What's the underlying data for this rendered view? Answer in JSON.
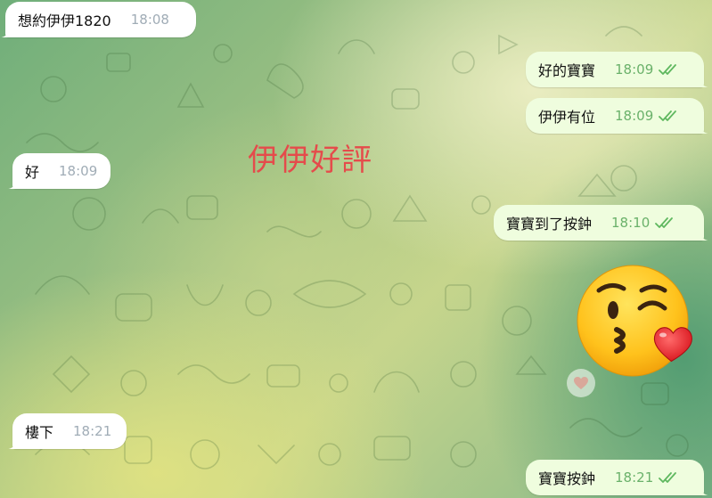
{
  "chat": {
    "overlay_title": "伊伊好評",
    "colors": {
      "incoming_bubble": "#ffffff",
      "outgoing_bubble": "#effdde",
      "outgoing_time": "#6ab16a",
      "incoming_time": "#a0acb6",
      "overlay_text": "#e54b4b"
    },
    "messages": [
      {
        "direction": "in",
        "text": "想約伊伊1820",
        "time": "18:08"
      },
      {
        "direction": "out",
        "text": "好的寶寶",
        "time": "18:09",
        "status": "read-double-check-icon"
      },
      {
        "direction": "out",
        "text": "伊伊有位",
        "time": "18:09",
        "status": "read-double-check-icon"
      },
      {
        "direction": "in",
        "text": "好",
        "time": "18:09"
      },
      {
        "direction": "out",
        "text": "寶寶到了按鈡",
        "time": "18:10",
        "status": "read-double-check-icon"
      },
      {
        "direction": "in",
        "text": "樓下",
        "time": "18:21"
      },
      {
        "direction": "out",
        "text": "寶寶按鈡",
        "time": "18:21",
        "status": "read-double-check-icon"
      }
    ],
    "sticker": {
      "icon": "kissing-face-with-heart-icon",
      "reaction_icon": "heart-icon"
    }
  }
}
